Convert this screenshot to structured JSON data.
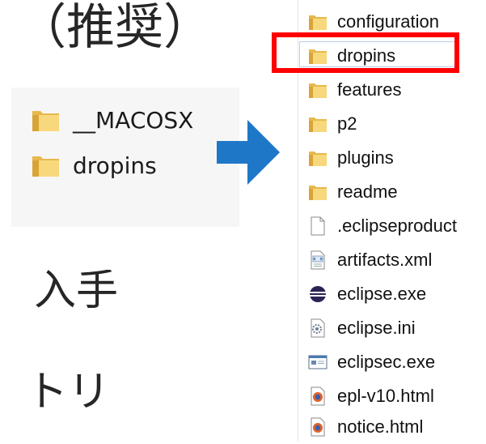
{
  "slide": {
    "title_fragment": "（推奨）",
    "text_fragment_1": "入手",
    "text_fragment_2": "トリ"
  },
  "zip_panel": {
    "items": [
      {
        "label": "__MACOSX",
        "icon": "folder-icon"
      },
      {
        "label": "dropins",
        "icon": "folder-icon"
      }
    ]
  },
  "arrow": {
    "icon": "arrow-right-icon",
    "color": "#1f77c8"
  },
  "file_list": {
    "highlighted": "dropins",
    "highlight_color": "#ff0000",
    "items": [
      {
        "label": "configuration",
        "icon": "folder-icon"
      },
      {
        "label": "dropins",
        "icon": "folder-icon"
      },
      {
        "label": "features",
        "icon": "folder-icon"
      },
      {
        "label": "p2",
        "icon": "folder-icon"
      },
      {
        "label": "plugins",
        "icon": "folder-icon"
      },
      {
        "label": "readme",
        "icon": "folder-icon"
      },
      {
        "label": ".eclipseproduct",
        "icon": "blank-file-icon"
      },
      {
        "label": "artifacts.xml",
        "icon": "xml-file-icon"
      },
      {
        "label": "eclipse.exe",
        "icon": "eclipse-exe-icon"
      },
      {
        "label": "eclipse.ini",
        "icon": "ini-file-icon"
      },
      {
        "label": "eclipsec.exe",
        "icon": "console-exe-icon"
      },
      {
        "label": "epl-v10.html",
        "icon": "html-file-icon"
      },
      {
        "label": "notice.html",
        "icon": "html-file-icon"
      }
    ]
  }
}
